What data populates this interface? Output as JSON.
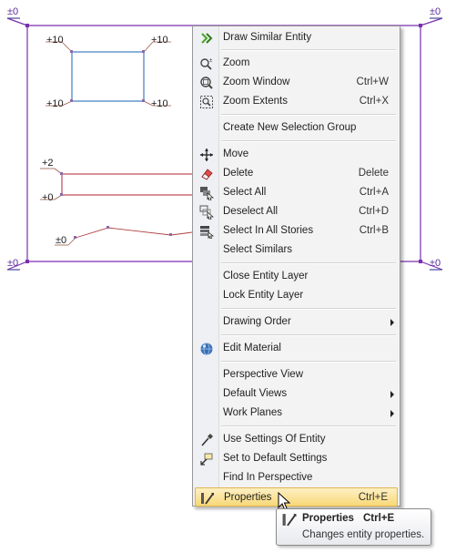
{
  "drawing": {
    "frame_labels": [
      "±0",
      "±0",
      "±0",
      "±0"
    ],
    "rect_labels": [
      "+10",
      "+10",
      "+10",
      "+10"
    ],
    "beam_labels": [
      "+2",
      "+0"
    ],
    "polyline_label": "±0"
  },
  "menu": {
    "items": [
      {
        "label": "Draw Similar Entity",
        "shortcut": "",
        "icon": "draw-similar-icon"
      },
      {
        "label": "Zoom",
        "shortcut": "",
        "icon": "zoom-icon"
      },
      {
        "label": "Zoom Window",
        "shortcut": "Ctrl+W",
        "icon": "zoom-window-icon"
      },
      {
        "label": "Zoom Extents",
        "shortcut": "Ctrl+X",
        "icon": "zoom-extents-icon"
      },
      {
        "label": "Create New Selection Group",
        "shortcut": ""
      },
      {
        "label": "Move",
        "shortcut": "",
        "icon": "move-icon"
      },
      {
        "label": "Delete",
        "shortcut": "Delete",
        "icon": "eraser-icon"
      },
      {
        "label": "Select All",
        "shortcut": "Ctrl+A",
        "icon": "select-all-icon"
      },
      {
        "label": "Deselect All",
        "shortcut": "Ctrl+D",
        "icon": "deselect-all-icon"
      },
      {
        "label": "Select In All Stories",
        "shortcut": "Ctrl+B",
        "icon": "select-stories-icon"
      },
      {
        "label": "Select Similars",
        "shortcut": ""
      },
      {
        "label": "Close Entity Layer",
        "shortcut": ""
      },
      {
        "label": "Lock Entity Layer",
        "shortcut": ""
      },
      {
        "label": "Drawing Order",
        "shortcut": "",
        "submenu": true
      },
      {
        "label": "Edit Material",
        "shortcut": "",
        "icon": "material-globe-icon"
      },
      {
        "label": "Perspective View",
        "shortcut": ""
      },
      {
        "label": "Default Views",
        "shortcut": "",
        "submenu": true
      },
      {
        "label": "Work Planes",
        "shortcut": "",
        "submenu": true
      },
      {
        "label": "Use Settings Of Entity",
        "shortcut": "",
        "icon": "eyedropper-icon"
      },
      {
        "label": "Set to Default Settings",
        "shortcut": "",
        "icon": "default-settings-icon"
      },
      {
        "label": "Find In Perspective",
        "shortcut": ""
      },
      {
        "label": "Properties",
        "shortcut": "Ctrl+E",
        "icon": "properties-icon",
        "highlighted": true
      }
    ]
  },
  "tooltip": {
    "title": "Properties",
    "shortcut": "Ctrl+E",
    "description": "Changes entity properties."
  }
}
